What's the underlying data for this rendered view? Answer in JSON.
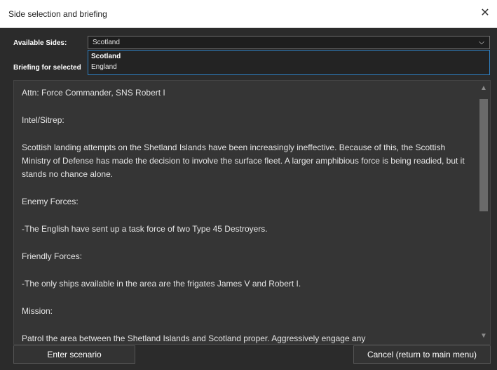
{
  "window": {
    "title": "Side selection and briefing"
  },
  "sides": {
    "label": "Available Sides:",
    "selected": "Scotland",
    "options": [
      "Scotland",
      "England"
    ]
  },
  "briefing": {
    "label": "Briefing for selected",
    "paragraphs": [
      "Attn: Force Commander, SNS Robert I",
      "Intel/Sitrep:",
      "Scottish landing attempts on the Shetland Islands have been increasingly ineffective. Because of this, the Scottish Ministry of Defense has made the decision to involve the surface fleet. A larger amphibious force is being readied, but it stands no chance alone.",
      "Enemy Forces:",
      "-The English have sent up a task force of two Type 45 Destroyers.",
      "Friendly Forces:",
      "-The only ships available in the area are the frigates James V and Robert I.",
      "Mission:",
      "Patrol the area between the Shetland Islands and Scotland proper. Aggressively engage any"
    ]
  },
  "buttons": {
    "enter": "Enter scenario",
    "cancel": "Cancel (return to main menu)"
  },
  "icons": {
    "close": "close-icon",
    "dropdown": "chevron-down-icon",
    "scroll_up": "scroll-up-icon",
    "scroll_down": "scroll-down-icon"
  },
  "colors": {
    "background": "#2b2b2b",
    "panel": "#353535",
    "dropdown_border": "#2f7fc0",
    "text": "#e4e4e4"
  }
}
